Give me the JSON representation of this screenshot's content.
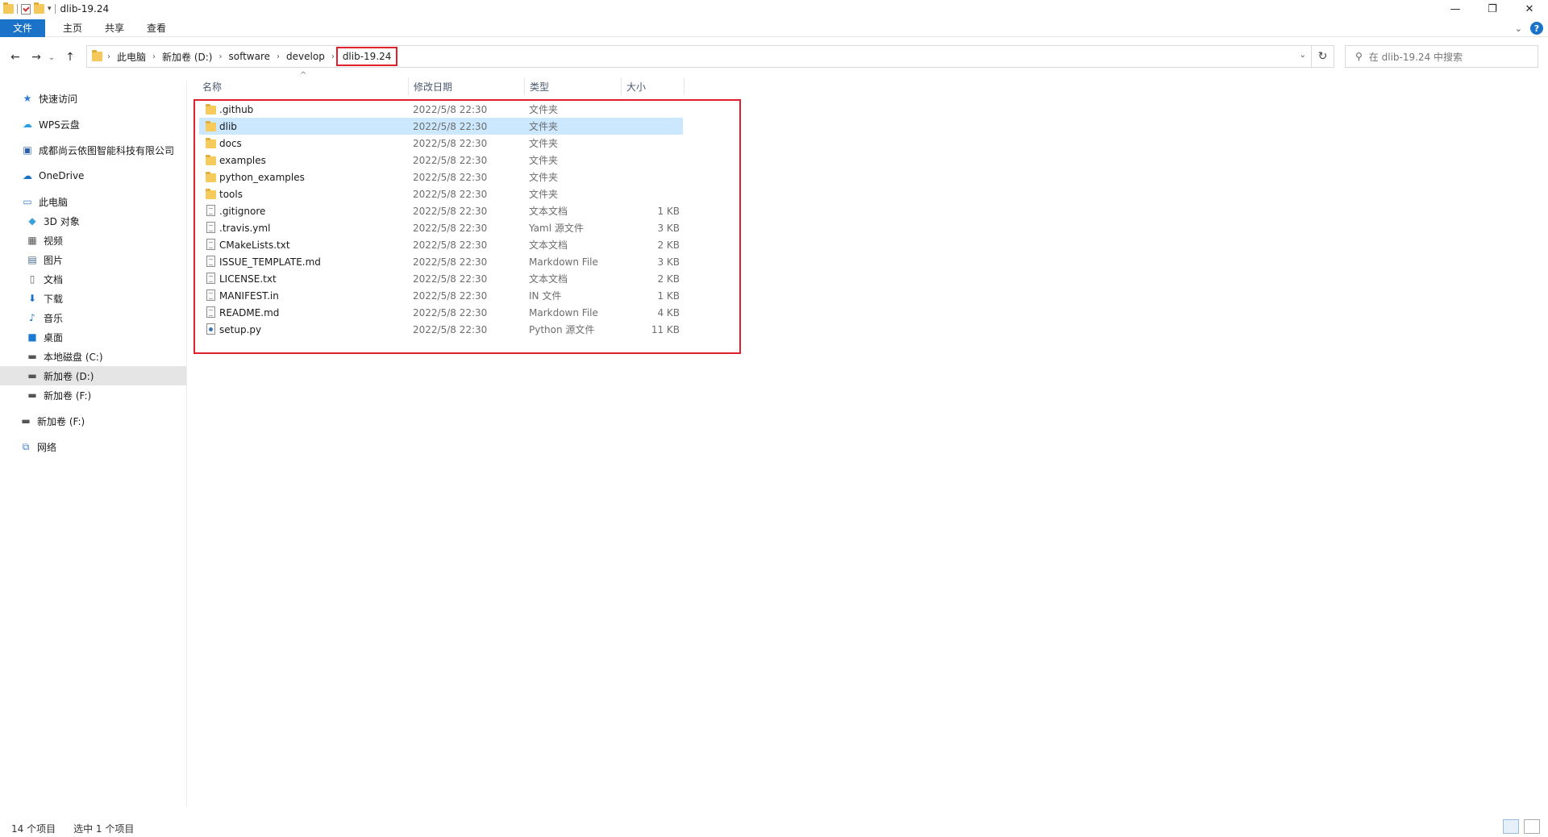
{
  "window": {
    "title": "dlib-19.24",
    "minimize": "—",
    "maximize": "❐",
    "close": "✕"
  },
  "ribbon": {
    "tabs": [
      "文件",
      "主页",
      "共享",
      "查看"
    ]
  },
  "nav": {
    "back": "←",
    "forward": "→",
    "recent": "⌄",
    "up": "↑"
  },
  "address": {
    "crumbs": [
      "此电脑",
      "新加卷 (D:)",
      "software",
      "develop"
    ],
    "current": "dlib-19.24",
    "refresh": "↻"
  },
  "search": {
    "placeholder": "在 dlib-19.24 中搜索"
  },
  "sidebar": {
    "items": [
      {
        "label": "快速访问",
        "icon": "star-icon"
      },
      {
        "label": "WPS云盘",
        "icon": "cloud-icon"
      },
      {
        "label": "成都尚云依图智能科技有限公司",
        "icon": "company-icon"
      },
      {
        "label": "OneDrive",
        "icon": "onedrive-icon"
      },
      {
        "label": "此电脑",
        "icon": "computer-icon"
      },
      {
        "label": "3D 对象",
        "icon": "cube-icon"
      },
      {
        "label": "视频",
        "icon": "video-icon"
      },
      {
        "label": "图片",
        "icon": "picture-icon"
      },
      {
        "label": "文档",
        "icon": "document-icon"
      },
      {
        "label": "下载",
        "icon": "download-icon"
      },
      {
        "label": "音乐",
        "icon": "music-icon"
      },
      {
        "label": "桌面",
        "icon": "desktop-icon"
      },
      {
        "label": "本地磁盘 (C:)",
        "icon": "drive-icon"
      },
      {
        "label": "新加卷 (D:)",
        "icon": "drive-icon"
      },
      {
        "label": "新加卷 (F:)",
        "icon": "drive-icon"
      },
      {
        "label": "新加卷 (F:)",
        "icon": "drive-icon"
      },
      {
        "label": "网络",
        "icon": "network-icon"
      }
    ]
  },
  "columns": {
    "name": "名称",
    "date": "修改日期",
    "type": "类型",
    "size": "大小"
  },
  "files": [
    {
      "name": ".github",
      "date": "2022/5/8 22:30",
      "type": "文件夹",
      "size": "",
      "kind": "folder"
    },
    {
      "name": "dlib",
      "date": "2022/5/8 22:30",
      "type": "文件夹",
      "size": "",
      "kind": "folder"
    },
    {
      "name": "docs",
      "date": "2022/5/8 22:30",
      "type": "文件夹",
      "size": "",
      "kind": "folder"
    },
    {
      "name": "examples",
      "date": "2022/5/8 22:30",
      "type": "文件夹",
      "size": "",
      "kind": "folder"
    },
    {
      "name": "python_examples",
      "date": "2022/5/8 22:30",
      "type": "文件夹",
      "size": "",
      "kind": "folder"
    },
    {
      "name": "tools",
      "date": "2022/5/8 22:30",
      "type": "文件夹",
      "size": "",
      "kind": "folder"
    },
    {
      "name": ".gitignore",
      "date": "2022/5/8 22:30",
      "type": "文本文档",
      "size": "1 KB",
      "kind": "doc"
    },
    {
      "name": ".travis.yml",
      "date": "2022/5/8 22:30",
      "type": "Yaml 源文件",
      "size": "3 KB",
      "kind": "doc"
    },
    {
      "name": "CMakeLists.txt",
      "date": "2022/5/8 22:30",
      "type": "文本文档",
      "size": "2 KB",
      "kind": "doc"
    },
    {
      "name": "ISSUE_TEMPLATE.md",
      "date": "2022/5/8 22:30",
      "type": "Markdown File",
      "size": "3 KB",
      "kind": "doc"
    },
    {
      "name": "LICENSE.txt",
      "date": "2022/5/8 22:30",
      "type": "文本文档",
      "size": "2 KB",
      "kind": "doc"
    },
    {
      "name": "MANIFEST.in",
      "date": "2022/5/8 22:30",
      "type": "IN 文件",
      "size": "1 KB",
      "kind": "doc"
    },
    {
      "name": "README.md",
      "date": "2022/5/8 22:30",
      "type": "Markdown File",
      "size": "4 KB",
      "kind": "doc"
    },
    {
      "name": "setup.py",
      "date": "2022/5/8 22:30",
      "type": "Python 源文件",
      "size": "11 KB",
      "kind": "py"
    }
  ],
  "selected_file": "dlib",
  "status": {
    "count": "14 个项目",
    "selected": "选中 1 个项目"
  },
  "colors": {
    "accent": "#1a73c8",
    "selection": "#cce8ff",
    "highlight": "#e0202a"
  }
}
